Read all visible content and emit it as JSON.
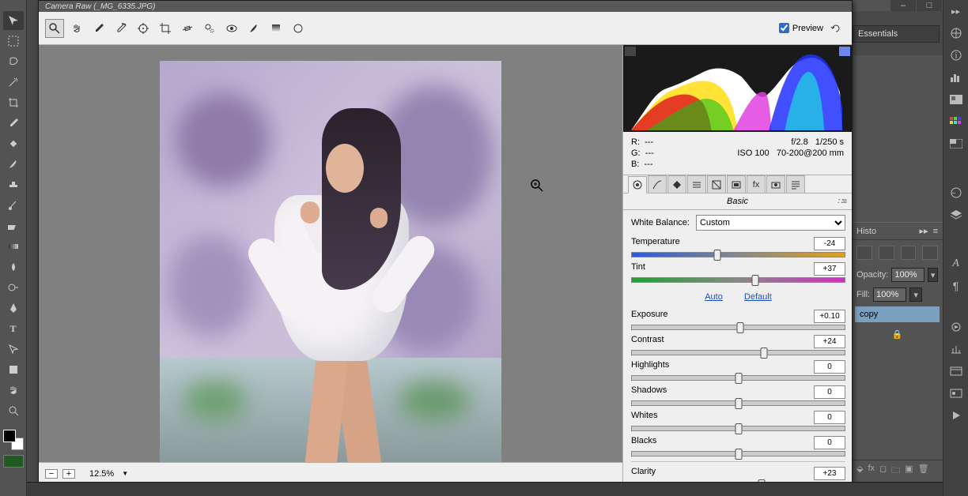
{
  "window": {
    "title": "Camera Raw (_MG_6335.JPG)"
  },
  "craw_tools": [
    {
      "name": "zoom-icon",
      "sel": true
    },
    {
      "name": "hand-icon",
      "sel": false
    },
    {
      "name": "white-balance-icon",
      "sel": false
    },
    {
      "name": "color-sampler-icon",
      "sel": false
    },
    {
      "name": "target-adjust-icon",
      "sel": false
    },
    {
      "name": "crop-icon",
      "sel": false
    },
    {
      "name": "straighten-icon",
      "sel": false
    },
    {
      "name": "spot-removal-icon",
      "sel": false
    },
    {
      "name": "redeye-icon",
      "sel": false
    },
    {
      "name": "adjustment-brush-icon",
      "sel": false
    },
    {
      "name": "graduated-filter-icon",
      "sel": false
    },
    {
      "name": "radial-filter-icon",
      "sel": false
    }
  ],
  "preview": {
    "label": "Preview",
    "checked": true
  },
  "rotate": {
    "name": "rotate-icon"
  },
  "zoom_controls": {
    "minus": "−",
    "plus": "+",
    "level": "12.5%"
  },
  "rgb": {
    "r_label": "R:",
    "g_label": "G:",
    "b_label": "B:",
    "r": "---",
    "g": "---",
    "b": "---"
  },
  "exif": {
    "aperture": "f/2.8",
    "shutter": "1/250 s",
    "iso": "ISO 100",
    "lens": "70-200@200 mm"
  },
  "panel_tabs": [
    {
      "name": "basic-tab",
      "sel": true
    },
    {
      "name": "curve-tab"
    },
    {
      "name": "detail-tab"
    },
    {
      "name": "hsl-tab"
    },
    {
      "name": "split-tab"
    },
    {
      "name": "lens-tab"
    },
    {
      "name": "fx-tab"
    },
    {
      "name": "camera-tab"
    },
    {
      "name": "presets-tab"
    }
  ],
  "panel_title": "Basic",
  "wb": {
    "label": "White Balance:",
    "selected": "Custom"
  },
  "auto_link": "Auto",
  "default_link": "Default",
  "sliders": {
    "temperature": {
      "label": "Temperature",
      "value": "-24",
      "pos": 40,
      "track": "temp"
    },
    "tint": {
      "label": "Tint",
      "value": "+37",
      "pos": 58,
      "track": "tint"
    },
    "exposure": {
      "label": "Exposure",
      "value": "+0.10",
      "pos": 51,
      "track": ""
    },
    "contrast": {
      "label": "Contrast",
      "value": "+24",
      "pos": 62,
      "track": ""
    },
    "highlights": {
      "label": "Highlights",
      "value": "0",
      "pos": 50,
      "track": ""
    },
    "shadows": {
      "label": "Shadows",
      "value": "0",
      "pos": 50,
      "track": ""
    },
    "whites": {
      "label": "Whites",
      "value": "0",
      "pos": 50,
      "track": ""
    },
    "blacks": {
      "label": "Blacks",
      "value": "0",
      "pos": 50,
      "track": ""
    },
    "clarity": {
      "label": "Clarity",
      "value": "+23",
      "pos": 61,
      "track": ""
    }
  },
  "essentials": "Essentials",
  "right_panels": {
    "history_tab": "Histo",
    "opacity_label": "Opacity:",
    "opacity_value": "100%",
    "fill_label": "Fill:",
    "fill_value": "100%",
    "layer_name": "copy"
  }
}
